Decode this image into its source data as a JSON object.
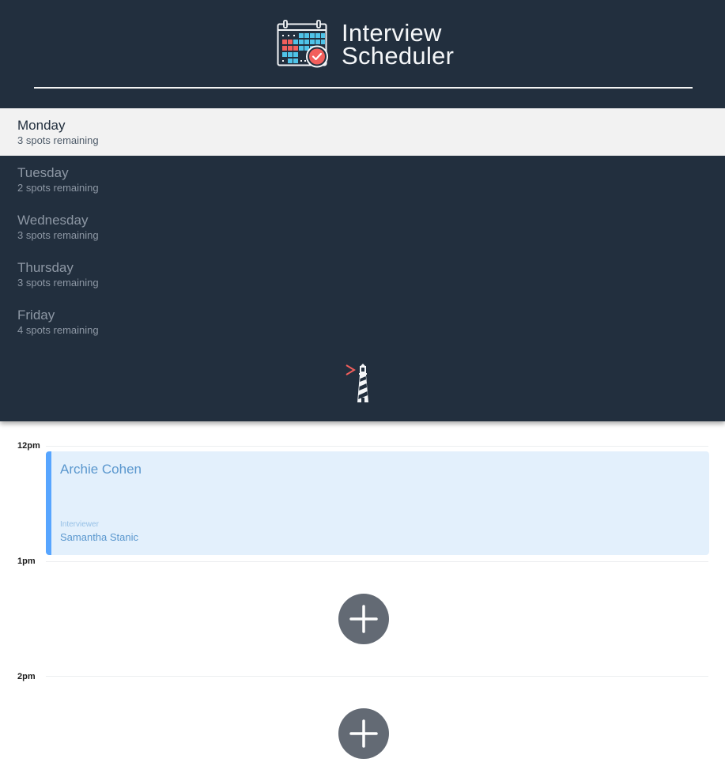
{
  "header": {
    "title_line1": "Interview",
    "title_line2": "Scheduler",
    "logo_icon": "calendar-check-icon"
  },
  "days": [
    {
      "name": "Monday",
      "spots": "3 spots remaining",
      "selected": true
    },
    {
      "name": "Tuesday",
      "spots": "2 spots remaining",
      "selected": false
    },
    {
      "name": "Wednesday",
      "spots": "3 spots remaining",
      "selected": false
    },
    {
      "name": "Thursday",
      "spots": "3 spots remaining",
      "selected": false
    },
    {
      "name": "Friday",
      "spots": "4 spots remaining",
      "selected": false
    }
  ],
  "footer_logo": "lighthouse-icon",
  "schedule": {
    "hours": [
      "12pm",
      "1pm",
      "2pm"
    ],
    "appointment": {
      "student": "Archie Cohen",
      "interviewer_label": "Interviewer",
      "interviewer": "Samantha Stanic"
    },
    "add_icon": "plus-icon"
  },
  "colors": {
    "sidebar_bg": "#222f3e",
    "selected_day_bg": "#f2f2f2",
    "appointment_bg": "#e3f0fc",
    "appointment_accent": "#57a5ff",
    "add_button": "#636a74",
    "logo_red": "#f25f5c",
    "logo_cyan": "#4fc3e8"
  }
}
